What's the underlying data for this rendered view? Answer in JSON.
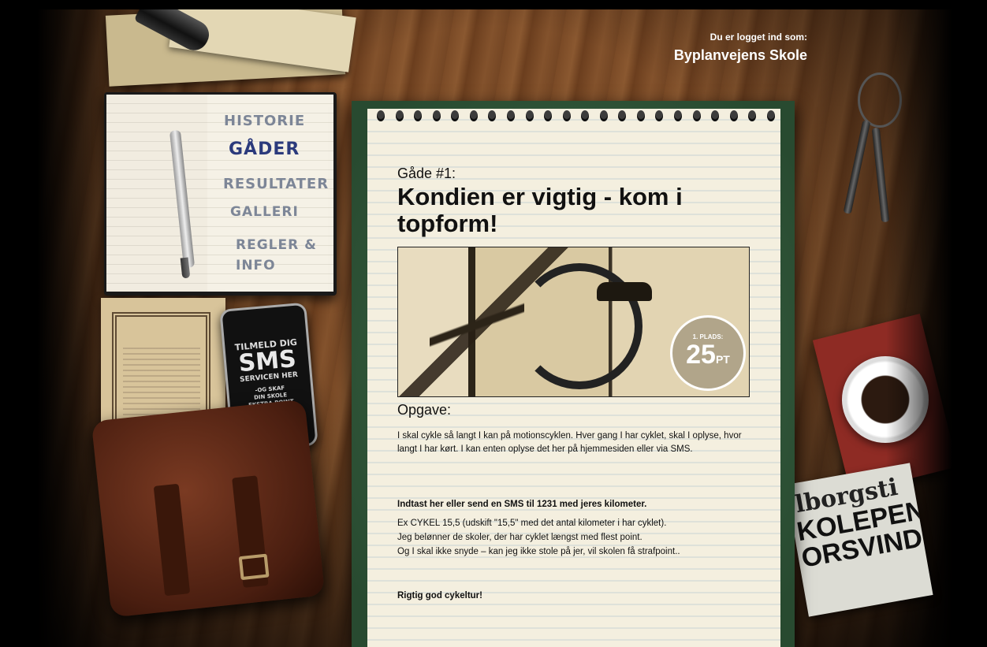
{
  "login": {
    "label": "Du er logget ind som:",
    "school": "Byplanvejens Skole"
  },
  "menu": {
    "items": [
      {
        "label": "HISTORIE",
        "active": false
      },
      {
        "label": "GÅDER",
        "active": true
      },
      {
        "label": "RESULTATER",
        "active": false
      },
      {
        "label": "GALLERI",
        "active": false
      },
      {
        "label": "REGLER &",
        "active": false
      },
      {
        "label": "INFO",
        "active": false
      }
    ]
  },
  "sms_promo": {
    "line1": "TILMELD DIG",
    "line2": "SMS",
    "line3": "SERVICEN HER",
    "line4a": "-OG SKAF",
    "line4b": "DIN SKOLE",
    "line4c": "EKSTRA POINT"
  },
  "riddle": {
    "number": "Gåde #1:",
    "title": "Kondien er vigtig - kom i topform!",
    "badge_place": "1. PLADS:",
    "badge_points": "25",
    "badge_unit": "PT",
    "task_heading": "Opgave:",
    "task_text": "I skal cykle så langt I kan på motionscyklen. Hver gang I har cyklet, skal I oplyse, hvor langt I har kørt. I kan enten oplyse det her på hjemmesiden eller via SMS.",
    "instruction_bold": "Indtast her eller send en SMS til 1231 med jeres kilometer.",
    "instruction_1": "Ex CYKEL 15,5 (udskift \"15,5\" med det antal kilometer i har cyklet).",
    "instruction_2": "Jeg belønner de skoler, der har cyklet længst med flest point.",
    "instruction_3": "Og I skal ikke snyde – kan jeg ikke stole på jer, vil skolen få strafpoint..",
    "closing": "Rigtig god cykeltur!"
  },
  "newspaper": {
    "line1": "lborgsti",
    "line2": "KOLEPENG",
    "line3": "ORSVIND"
  },
  "colors": {
    "active_menu": "#2b3a7c",
    "menu": "#7d8697",
    "pad_frame": "#3f6a48"
  }
}
